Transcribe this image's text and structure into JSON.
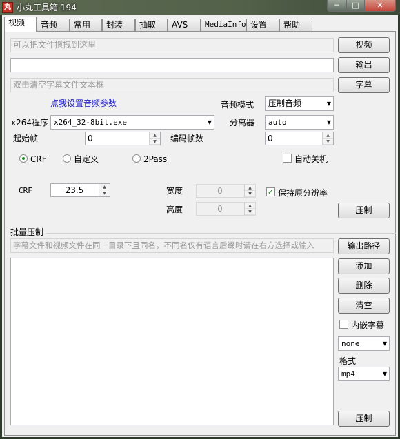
{
  "window": {
    "title": "小丸工具箱 194",
    "icon_text": "丸",
    "min_glyph": "─",
    "max_glyph": "□",
    "close_glyph": "✕"
  },
  "tabs": [
    "视频",
    "音频",
    "常用",
    "封装",
    "抽取",
    "AVS",
    "MediaInfo",
    "设置",
    "帮助"
  ],
  "video_tab": {
    "drop_placeholder": "可以把文件拖拽到这里",
    "output_value": "",
    "subtitle_placeholder": "双击清空字幕文件文本框",
    "video_button": "视频",
    "output_button": "输出",
    "subtitle_button": "字幕",
    "audio_params_link": "点我设置音频参数",
    "audio_mode_label": "音频模式",
    "audio_mode_value": "压制音频",
    "x264_label": "x264程序",
    "x264_value": "x264_32-8bit.exe",
    "demuxer_label": "分离器",
    "demuxer_value": "auto",
    "start_frame_label": "起始帧",
    "start_frame_value": "0",
    "encode_frames_label": "编码帧数",
    "encode_frames_value": "0",
    "modes": [
      "CRF",
      "自定义",
      "2Pass"
    ],
    "mode_selected": "CRF",
    "auto_shutdown_label": "自动关机",
    "auto_shutdown_checked": false,
    "crf_label": "CRF",
    "crf_value": "23.5",
    "width_label": "宽度",
    "width_value": "0",
    "height_label": "高度",
    "height_value": "0",
    "keep_resolution_label": "保持原分辨率",
    "keep_resolution_checked": true,
    "encode_button": "压制"
  },
  "batch": {
    "group_label": "批量压制",
    "hint": "字幕文件和视频文件在同一目录下且同名，不同名仅有语言后缀时请在右方选择或输入",
    "output_path_button": "输出路径",
    "add_button": "添加",
    "delete_button": "删除",
    "clear_button": "清空",
    "embed_subtitle_label": "内嵌字幕",
    "embed_subtitle_checked": false,
    "subtitle_lang_value": "none",
    "format_label": "格式",
    "format_value": "mp4",
    "encode_button": "压制"
  }
}
